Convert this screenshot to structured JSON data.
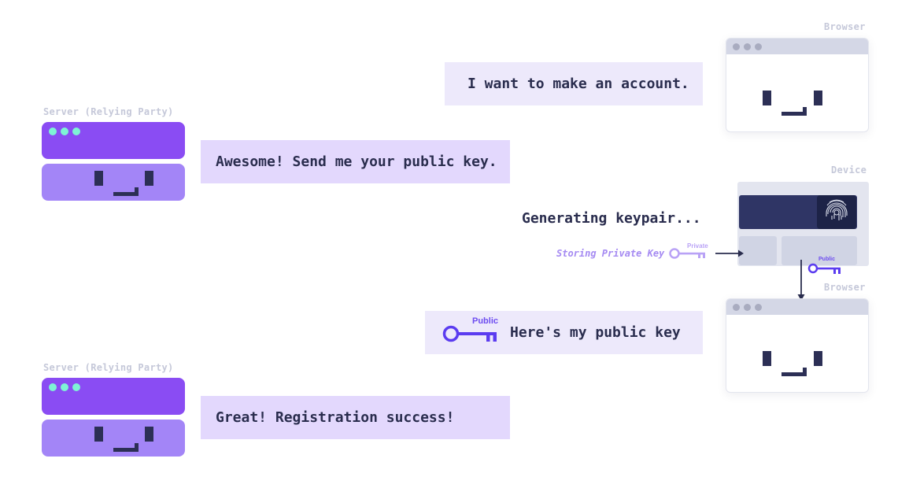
{
  "labels": {
    "browser_top": "Browser",
    "server_top": "Server (Relying Party)",
    "device": "Device",
    "browser_bottom": "Browser",
    "server_bottom": "Server (Relying Party)"
  },
  "messages": {
    "browser_request": "I want to make an account.",
    "server_reply": "Awesome! Send me your public key.",
    "browser_send": "Here's my public key",
    "server_success": "Great! Registration success!"
  },
  "device": {
    "status": "Generating keypair...",
    "storing_text": "Storing Private Key",
    "private_label": "Private",
    "public_label": "Public"
  },
  "key_label": "Public",
  "colors": {
    "server_top": "#8a4cf3",
    "server_bottom": "#a385f7",
    "server_dots": "#7ef3d5",
    "bubble_browser": "#ede9fb",
    "bubble_server": "#e3d8fd",
    "text_dark": "#2a2d4e",
    "key_public": "#5b3cf0",
    "key_private": "#b9a2f6",
    "device_screen": "#2f3565",
    "label_gray": "#c5c8d9"
  },
  "icons": [
    "server-box",
    "browser-window",
    "fingerprint-icon",
    "key-icon",
    "arrow-right",
    "arrow-down"
  ]
}
